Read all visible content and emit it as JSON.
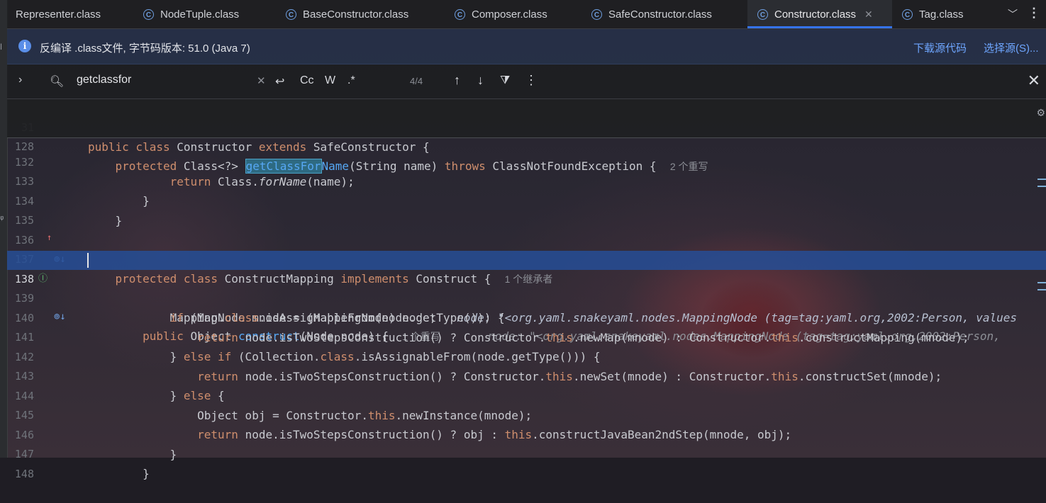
{
  "tabs": [
    {
      "label": "Representer.class",
      "icon": "class-icon",
      "active": false
    },
    {
      "label": "NodeTuple.class",
      "icon": "class-icon",
      "active": false
    },
    {
      "label": "BaseConstructor.class",
      "icon": "class-icon",
      "active": false
    },
    {
      "label": "Composer.class",
      "icon": "class-icon",
      "active": false
    },
    {
      "label": "SafeConstructor.class",
      "icon": "class-icon",
      "active": false
    },
    {
      "label": "Constructor.class",
      "icon": "class-icon",
      "active": true
    },
    {
      "label": "Tag.class",
      "icon": "class-icon",
      "active": false
    }
  ],
  "banner": {
    "message": "反编译 .class文件, 字节码版本: 51.0 (Java 7)",
    "download_source": "下载源代码",
    "choose_source": "选择源(S)..."
  },
  "search": {
    "query": "getclassfor",
    "match_case": "Cc",
    "words": "W",
    "regex": ".*",
    "result_count": "4/4"
  },
  "code": {
    "lines": [
      {
        "n": "31"
      },
      {
        "n": "128",
        "hint": "2 个重写"
      },
      {
        "n": "132"
      },
      {
        "n": "133"
      },
      {
        "n": "134"
      },
      {
        "n": "135"
      },
      {
        "n": "136",
        "hint": "1 个继承者"
      },
      {
        "n": "137",
        "hint": "1 个重写",
        "debug": "node: \"<org.yaml.snakeyaml.nodes.MappingNode (tag=tag:yaml.org,2002:Person,"
      },
      {
        "n": "138",
        "debug": "node: \"<org.yaml.snakeyaml.nodes.MappingNode (tag=tag:yaml.org,2002:Person, values"
      },
      {
        "n": "139"
      },
      {
        "n": "140"
      },
      {
        "n": "141"
      },
      {
        "n": "142"
      },
      {
        "n": "143"
      },
      {
        "n": "144"
      },
      {
        "n": "145"
      },
      {
        "n": "146"
      },
      {
        "n": "147"
      },
      {
        "n": "148"
      }
    ]
  },
  "colors": {
    "keyword": "#cf8e6d",
    "method": "#56a8f5",
    "accent": "#3574f0",
    "highlight_line": "#264e96"
  }
}
